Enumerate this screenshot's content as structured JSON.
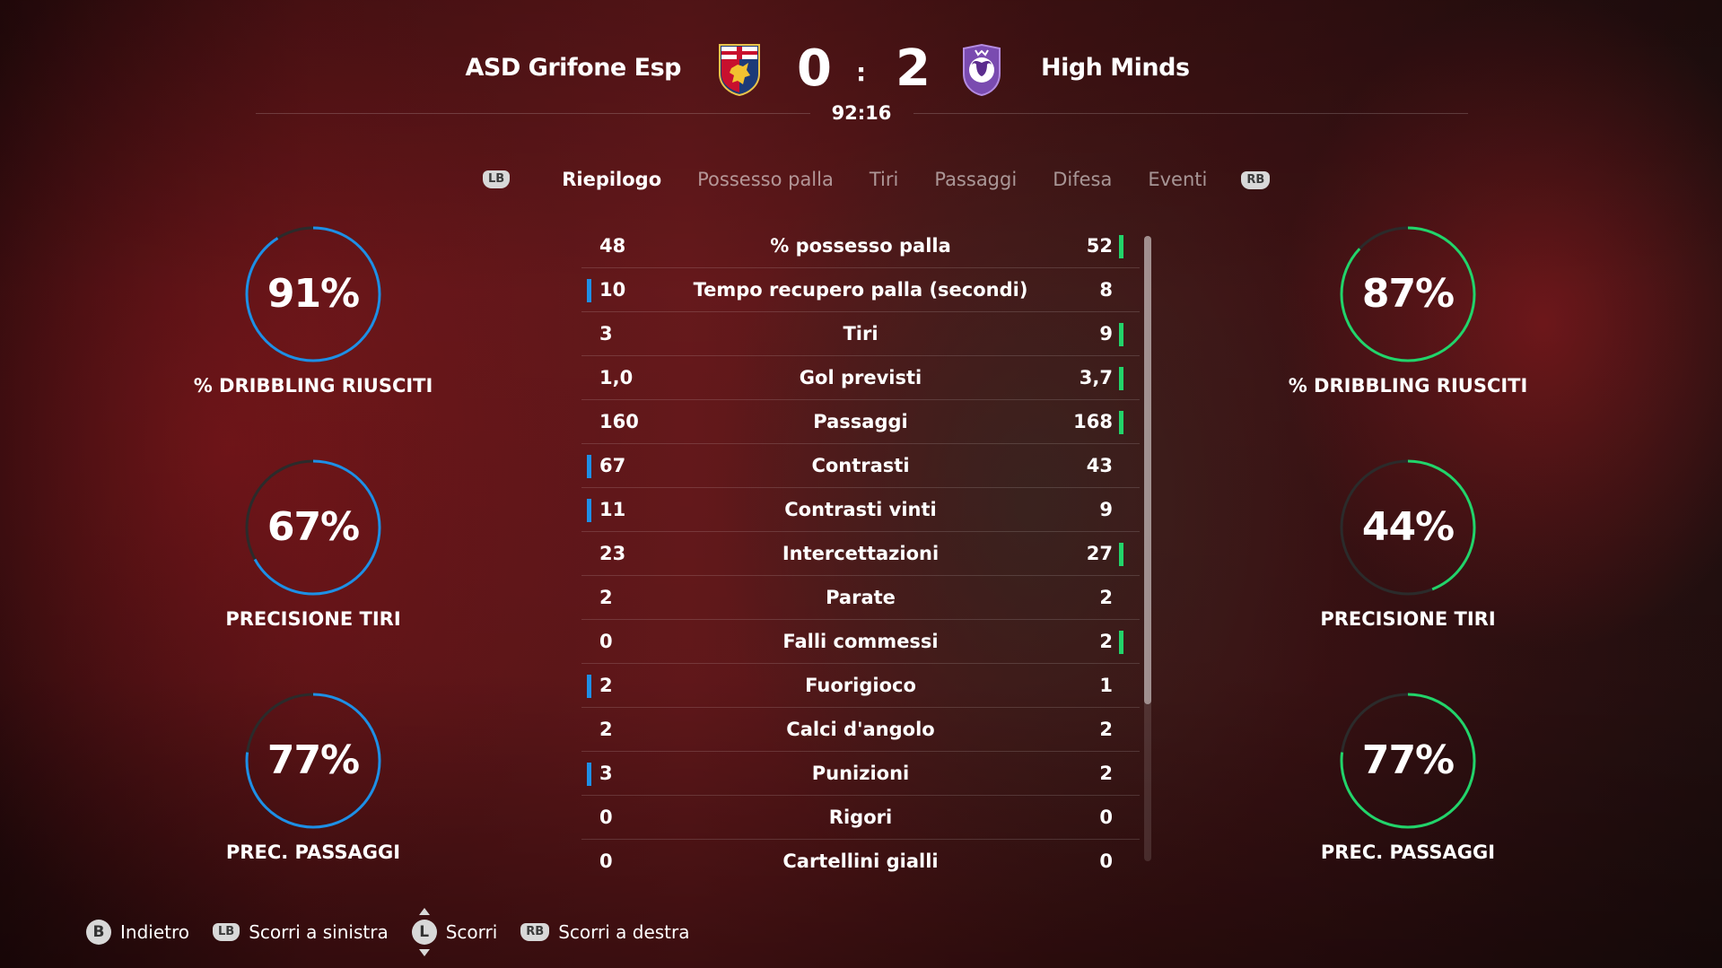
{
  "match": {
    "home_team": "ASD Grifone Esp",
    "away_team": "High Minds",
    "home_score": "0",
    "away_score": "2",
    "separator": ":",
    "clock": "92:16"
  },
  "tabs": {
    "left_button": "LB",
    "right_button": "RB",
    "items": [
      "Riepilogo",
      "Possesso palla",
      "Tiri",
      "Passaggi",
      "Difesa",
      "Eventi"
    ],
    "active": "Riepilogo"
  },
  "home_rings": [
    {
      "value": "91%",
      "percent": 91,
      "label": "% DRIBBLING RIUSCITI"
    },
    {
      "value": "67%",
      "percent": 67,
      "label": "PRECISIONE TIRI"
    },
    {
      "value": "77%",
      "percent": 77,
      "label": "PREC. PASSAGGI"
    }
  ],
  "away_rings": [
    {
      "value": "87%",
      "percent": 87,
      "label": "% DRIBBLING RIUSCITI"
    },
    {
      "value": "44%",
      "percent": 44,
      "label": "PRECISIONE TIRI"
    },
    {
      "value": "77%",
      "percent": 77,
      "label": "PREC. PASSAGGI"
    }
  ],
  "stats": [
    {
      "home": "48",
      "name": "% possesso palla",
      "away": "52",
      "leader": "away"
    },
    {
      "home": "10",
      "name": "Tempo recupero palla (secondi)",
      "away": "8",
      "leader": "home"
    },
    {
      "home": "3",
      "name": "Tiri",
      "away": "9",
      "leader": "away"
    },
    {
      "home": "1,0",
      "name": "Gol previsti",
      "away": "3,7",
      "leader": "away"
    },
    {
      "home": "160",
      "name": "Passaggi",
      "away": "168",
      "leader": "away"
    },
    {
      "home": "67",
      "name": "Contrasti",
      "away": "43",
      "leader": "home"
    },
    {
      "home": "11",
      "name": "Contrasti vinti",
      "away": "9",
      "leader": "home"
    },
    {
      "home": "23",
      "name": "Intercettazioni",
      "away": "27",
      "leader": "away"
    },
    {
      "home": "2",
      "name": "Parate",
      "away": "2",
      "leader": "none"
    },
    {
      "home": "0",
      "name": "Falli commessi",
      "away": "2",
      "leader": "away"
    },
    {
      "home": "2",
      "name": "Fuorigioco",
      "away": "1",
      "leader": "home"
    },
    {
      "home": "2",
      "name": "Calci d'angolo",
      "away": "2",
      "leader": "none"
    },
    {
      "home": "3",
      "name": "Punizioni",
      "away": "2",
      "leader": "home"
    },
    {
      "home": "0",
      "name": "Rigori",
      "away": "0",
      "leader": "none"
    },
    {
      "home": "0",
      "name": "Cartellini gialli",
      "away": "0",
      "leader": "none"
    }
  ],
  "footer": {
    "back_key": "B",
    "back_label": "Indietro",
    "lb_key": "LB",
    "left_label": "Scorri a sinistra",
    "stick_key": "L",
    "scroll_label": "Scorri",
    "rb_key": "RB",
    "right_label": "Scorri a destra"
  },
  "colors": {
    "home_accent": "#1e8fe6",
    "away_accent": "#22d46a",
    "ring_track": "#2b2b2b"
  },
  "icons": {
    "home_crest": "griffin-crest-icon",
    "away_crest": "bull-crest-icon"
  }
}
